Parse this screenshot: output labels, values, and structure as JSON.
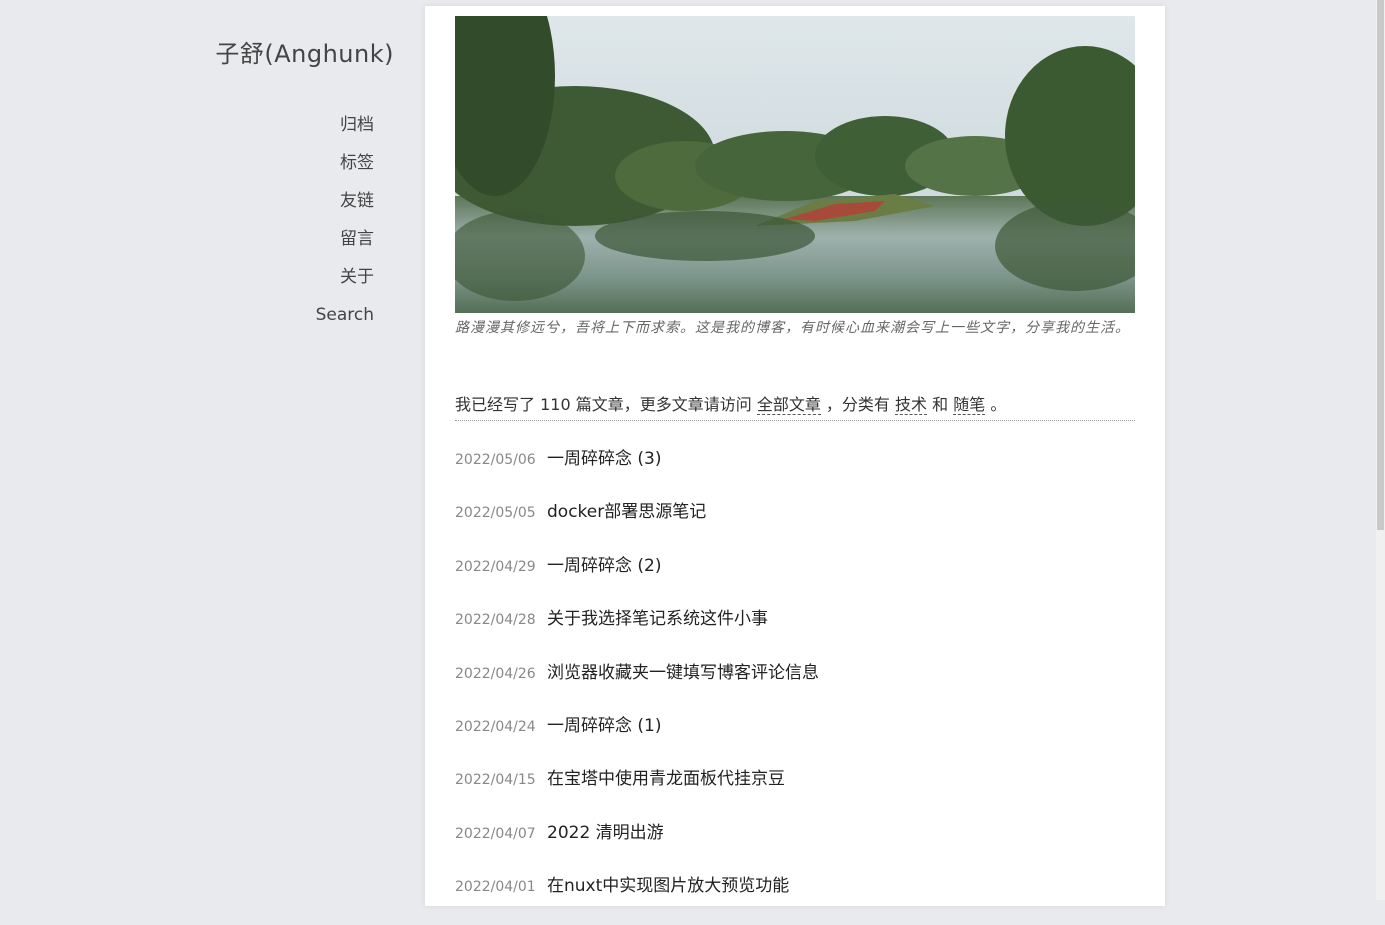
{
  "sidebar": {
    "site_title": "子舒(Anghunk)",
    "nav": [
      "归档",
      "标签",
      "友链",
      "留言",
      "关于",
      "Search"
    ]
  },
  "hero": {
    "image_name": "west-lake-landscape-image"
  },
  "motto": "路漫漫其修远兮，吾将上下而求索。这是我的博客，有时候心血来潮会写上一些文字，分享我的生活。",
  "summary": {
    "prefix": "我已经写了 110 篇文章，更多文章请访问",
    "all_posts_link": "全部文章",
    "mid": "，分类有",
    "cat_tech": "技术",
    "and": "和",
    "cat_essay": "随笔",
    "suffix": "。"
  },
  "posts": [
    {
      "date": "2022/05/06",
      "title": "一周碎碎念 (3)"
    },
    {
      "date": "2022/05/05",
      "title": "docker部署思源笔记"
    },
    {
      "date": "2022/04/29",
      "title": "一周碎碎念 (2)"
    },
    {
      "date": "2022/04/28",
      "title": "关于我选择笔记系统这件小事"
    },
    {
      "date": "2022/04/26",
      "title": "浏览器收藏夹一键填写博客评论信息"
    },
    {
      "date": "2022/04/24",
      "title": "一周碎碎念 (1)"
    },
    {
      "date": "2022/04/15",
      "title": "在宝塔中使用青龙面板代挂京豆"
    },
    {
      "date": "2022/04/07",
      "title": "2022 清明出游"
    },
    {
      "date": "2022/04/01",
      "title": "在nuxt中实现图片放大预览功能"
    }
  ]
}
